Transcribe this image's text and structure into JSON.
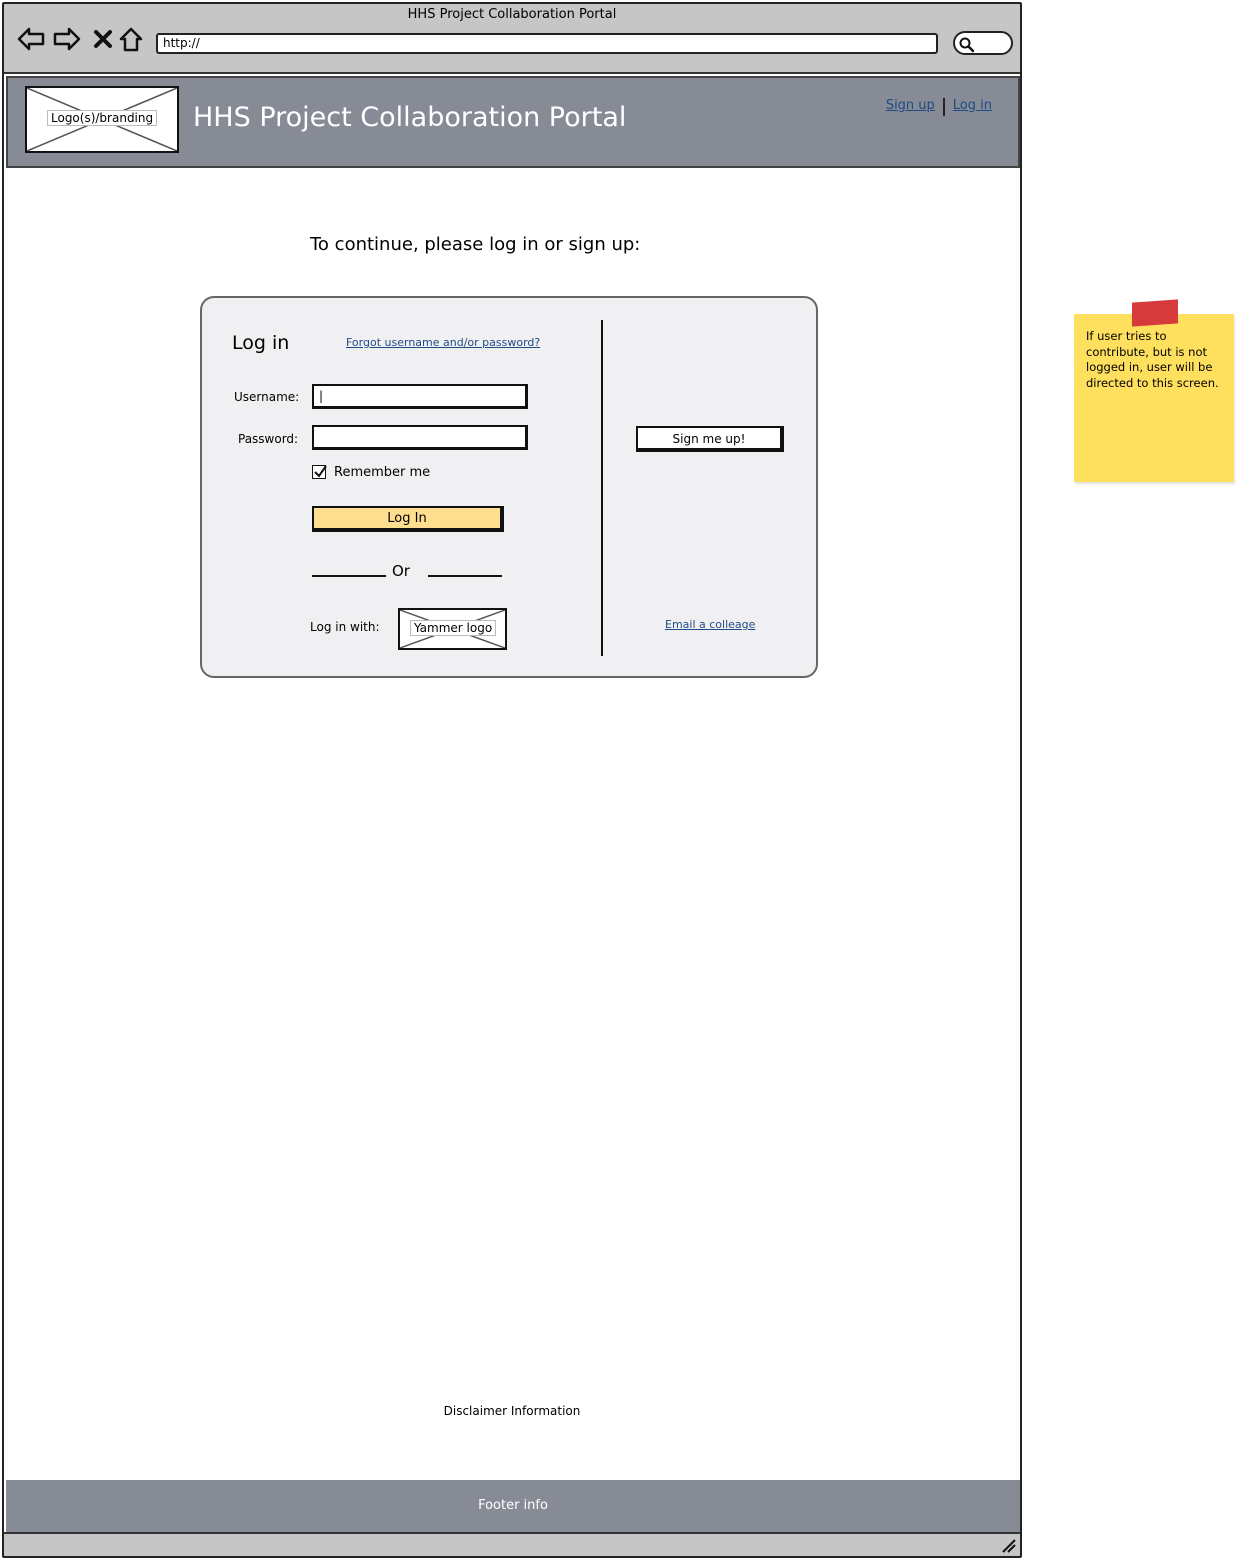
{
  "window": {
    "title": "HHS Project Collaboration Portal",
    "url": "http://"
  },
  "header": {
    "logo_label": "Logo(s)/branding",
    "title": "HHS Project Collaboration Portal",
    "signup_link": "Sign up",
    "login_link": "Log in"
  },
  "main": {
    "prompt": "To continue, please log in or sign up:",
    "login": {
      "heading": "Log in",
      "forgot_link": "Forgot username and/or password?",
      "username_label": "Username:",
      "username_value": "|",
      "password_label": "Password:",
      "password_value": "",
      "remember_label": "Remember me",
      "remember_checked": true,
      "login_button": "Log In",
      "or_label": "Or",
      "login_with_label": "Log in with:",
      "yammer_label": "Yammer logo"
    },
    "signup": {
      "button": "Sign me up!",
      "email_link": "Email a colleage"
    }
  },
  "footer": {
    "disclaimer": "Disclaimer Information",
    "info": "Footer info"
  },
  "sticky_note": {
    "text": "If user tries to contribute, but is not logged in, user will be directed to this screen."
  },
  "colors": {
    "header_bg": "#868b96",
    "chrome_bg": "#c6c6c6",
    "login_button_bg": "#ffdf8f",
    "link": "#1f4a86",
    "sticky_bg": "#ffe05e",
    "sticky_tape": "#d63a3a"
  },
  "icons": {
    "back": "back-arrow-icon",
    "forward": "forward-arrow-icon",
    "stop": "close-icon",
    "home": "home-icon",
    "search": "search-icon",
    "checkbox": "check-icon",
    "resize": "resize-grip-icon"
  }
}
